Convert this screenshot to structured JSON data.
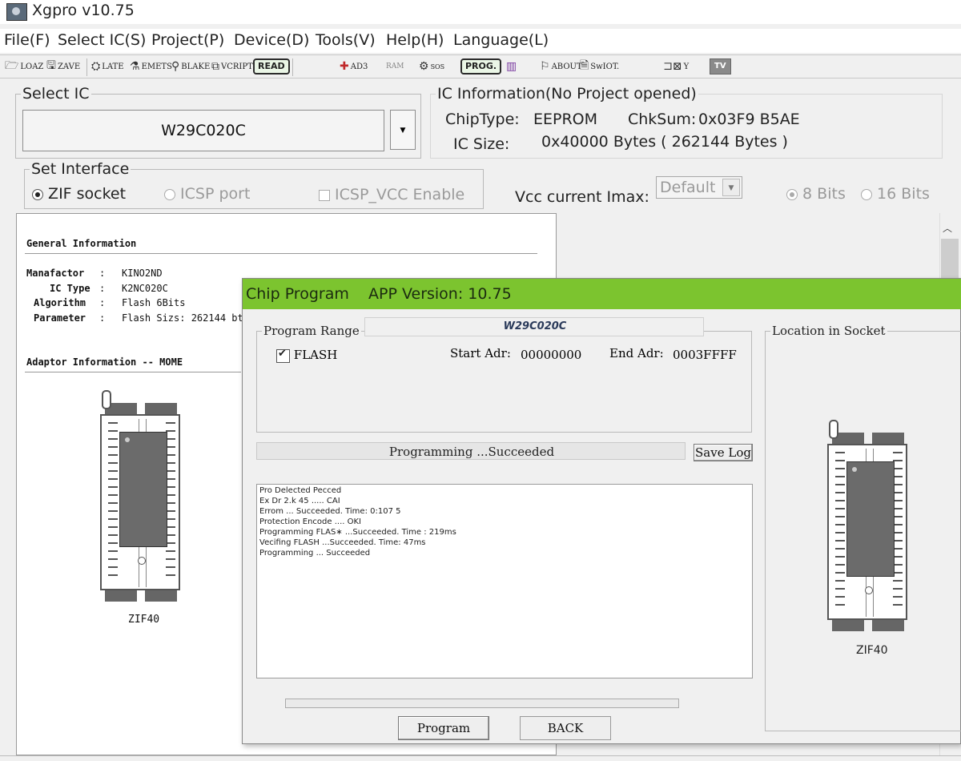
{
  "window": {
    "title": "Xgpro v10.75",
    "icon": "app-icon"
  },
  "menu": [
    "File(F)",
    "Select IC(S)",
    "Project(P)",
    "Device(D)",
    "Tools(V)",
    "Help(H)",
    "Language(L)"
  ],
  "toolbar": {
    "load": "LOAZ",
    "save": "ZAVE",
    "late": "LATE",
    "emets": "EMETS",
    "blake": "BLAKE",
    "vcript": "VCRIPT",
    "read": "READ",
    "ad3": "AD3",
    "ram": "RAM",
    "sos": "SOS",
    "prog": "PROG.",
    "about": "ABOUT",
    "swiot": "SwIOT.",
    "y": "Y",
    "tv": "TV"
  },
  "select_ic": {
    "legend": "Select IC",
    "value": "W29C020C"
  },
  "ic_info": {
    "legend": "IC Information(No Project opened)",
    "chiptype_label": "ChipType:",
    "chiptype_value": "EEPROM",
    "chksum_label": "ChkSum:",
    "chksum_value": "0x03F9 B5AE",
    "icsize_label": "IC Size:",
    "icsize_value": "0x40000 Bytes ( 262144 Bytes )"
  },
  "interface": {
    "legend": "Set Interface",
    "zif": "ZIF socket",
    "icsp": "ICSP port",
    "icsp_vcc": "ICSP_VCC Enable",
    "vcc_label": "Vcc current Imax:",
    "vcc_value": "Default",
    "bits8": "8 Bits",
    "bits16": "16 Bits"
  },
  "info_panel": {
    "general_heading": "General Information",
    "manufactor_label": "Manafactor",
    "manufactor_value": "KINO2ND",
    "ictype_label": "IC Type",
    "ictype_value": "K2NC020C",
    "algorithm_label": "Algorithm",
    "algorithm_value": "Flash 6Bits",
    "parameter_label": "Parameter",
    "parameter_value": "Flash Sizs: 262144 bt",
    "adaptor_heading": "Adaptor Information -- MOME",
    "socket_label": "ZIF40"
  },
  "dialog": {
    "title": "Chip Program",
    "app_version": "APP Version: 10.75",
    "chip_name": "W29C020C",
    "range_legend": "Program Range",
    "flash_label": "FLASH",
    "start_label": "Start Adr:",
    "start_value": "00000000",
    "end_label": "End Adr:",
    "end_value": "0003FFFF",
    "status": "Programming  ...Succeeded",
    "save_log": "Save Log",
    "log": [
      "Pro Delected Pecced",
      "Ex Dr 2.k 45 ..... CAI",
      "Errom ... Succeeded. Time: 0:107 5",
      "Protection Encode .... OKI",
      "Programming FLAS∗ ...Succeeded. Time : 219ms",
      "Vecifing FLASH ...Succeeded. Time: 47ms",
      "Programming ... Succeeded"
    ],
    "progress": 0,
    "location_legend": "Location in Socket",
    "socket_label": "ZIF40",
    "program_button": "Program",
    "back_button": "BACK"
  },
  "colors": {
    "dialog_title": "#7cc42f"
  }
}
